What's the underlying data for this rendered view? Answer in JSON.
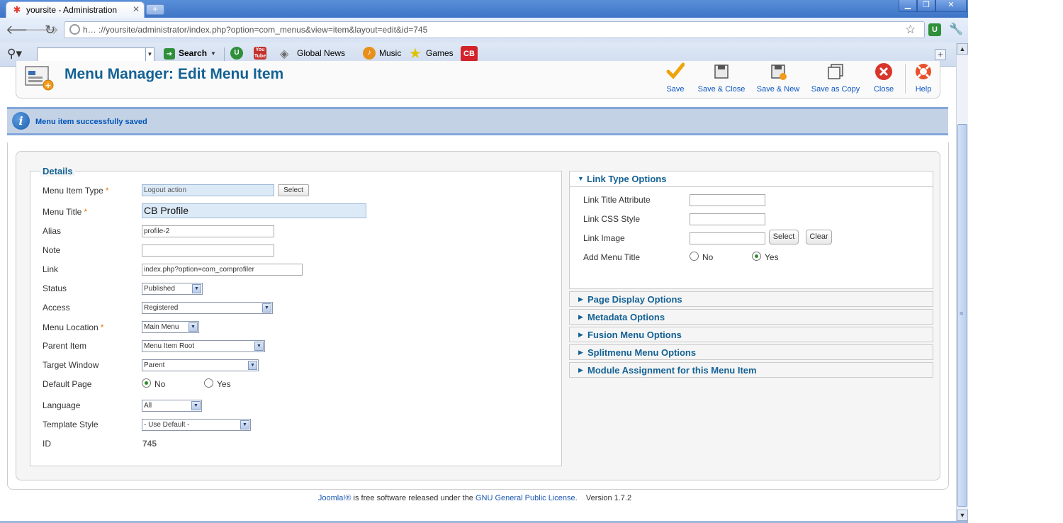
{
  "browser": {
    "tab_title": "yoursite - Administration",
    "tab_close": "✕",
    "new_tab": "+",
    "window_buttons": {
      "minimize": "▁",
      "maximize": "❐",
      "close": "✕"
    },
    "address_text": "h… ://yoursite/administrator/index.php?option=com_menus&view=item&layout=edit&id=745",
    "bookmarks": {
      "search_button": "Search",
      "items": [
        "Global News",
        "Music",
        "Games"
      ],
      "youtube_text": "You Tube",
      "cb_text": "CB",
      "plus": "+"
    }
  },
  "header": {
    "title": "Menu Manager: Edit Menu Item",
    "toolbar": {
      "save": "Save",
      "save_close": "Save & Close",
      "save_new": "Save & New",
      "save_copy": "Save as Copy",
      "close": "Close",
      "help": "Help"
    }
  },
  "message": {
    "icon": "i",
    "text": "Menu item successfully saved"
  },
  "details": {
    "legend": "Details",
    "required_marker": "*",
    "menu_item_type": {
      "label": "Menu Item Type",
      "value": "Logout action",
      "button": "Select"
    },
    "menu_title": {
      "label": "Menu Title",
      "value": "CB Profile"
    },
    "alias": {
      "label": "Alias",
      "value": "profile-2"
    },
    "note": {
      "label": "Note",
      "value": ""
    },
    "link": {
      "label": "Link",
      "value": "index.php?option=com_comprofiler"
    },
    "status": {
      "label": "Status",
      "value": "Published"
    },
    "access": {
      "label": "Access",
      "value": "Registered"
    },
    "menu_location": {
      "label": "Menu Location",
      "value": "Main Menu"
    },
    "parent_item": {
      "label": "Parent Item",
      "value": "Menu Item Root"
    },
    "target_window": {
      "label": "Target Window",
      "value": "Parent"
    },
    "default_page": {
      "label": "Default Page",
      "options": [
        "No",
        "Yes"
      ],
      "selected": "No"
    },
    "language": {
      "label": "Language",
      "value": "All"
    },
    "template_style": {
      "label": "Template Style",
      "value": "- Use Default -"
    },
    "id": {
      "label": "ID",
      "value": "745"
    }
  },
  "link_type_options": {
    "title": "Link Type Options",
    "link_title_attribute": {
      "label": "Link Title Attribute",
      "value": ""
    },
    "link_css_style": {
      "label": "Link CSS Style",
      "value": ""
    },
    "link_image": {
      "label": "Link Image",
      "value": "",
      "select": "Select",
      "clear": "Clear"
    },
    "add_menu_title": {
      "label": "Add Menu Title",
      "options": [
        "No",
        "Yes"
      ],
      "selected": "Yes"
    }
  },
  "accordion": [
    "Page Display Options",
    "Metadata Options",
    "Fusion Menu Options",
    "Splitmenu Menu Options",
    "Module Assignment for this Menu Item"
  ],
  "footer": {
    "joomla_link": "Joomla!®",
    "middle": " is free software released under the ",
    "license_link": "GNU General Public License",
    "version": ".    Version 1.7.2"
  },
  "colors": {
    "title_blue": "#146295",
    "message_bg": "#c3d2e5",
    "required": "#e47e00",
    "save_icon": "#f0a30a",
    "close_icon": "#d9352a"
  }
}
